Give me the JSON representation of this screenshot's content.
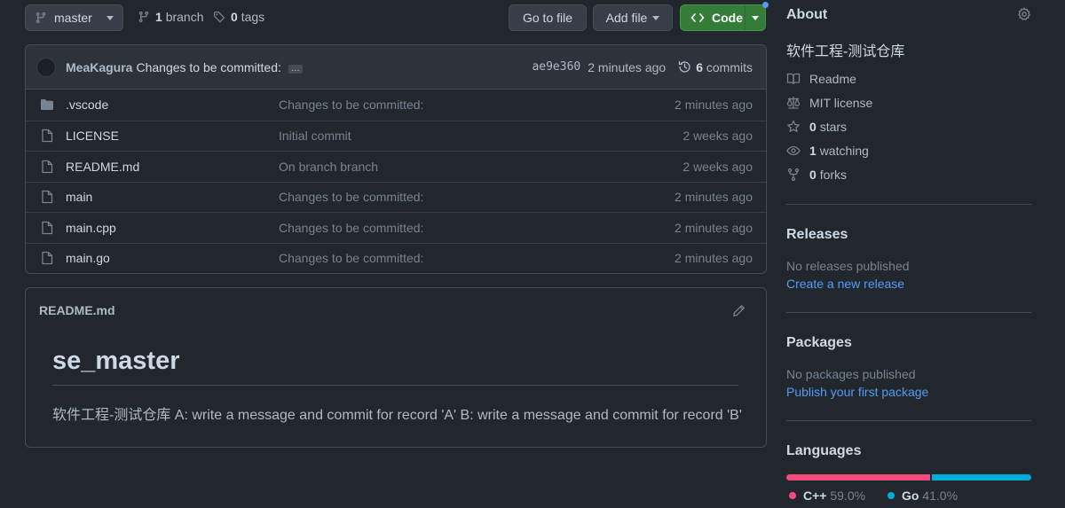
{
  "toolbar": {
    "branch_name": "master",
    "branches_count": "1",
    "branches_label": "branch",
    "tags_count": "0",
    "tags_label": "tags",
    "go_to_file": "Go to file",
    "add_file": "Add file",
    "code": "Code"
  },
  "commit": {
    "author": "MeaKagura",
    "message": "Changes to be committed:",
    "ellipsis": "…",
    "sha": "ae9e360",
    "time": "2 minutes ago",
    "commits_count": "6",
    "commits_label": "commits"
  },
  "files": [
    {
      "name": ".vscode",
      "type": "folder",
      "message": "Changes to be committed:",
      "age": "2 minutes ago"
    },
    {
      "name": "LICENSE",
      "type": "file",
      "message": "Initial commit",
      "age": "2 weeks ago"
    },
    {
      "name": "README.md",
      "type": "file",
      "message": "On branch branch",
      "age": "2 weeks ago"
    },
    {
      "name": "main",
      "type": "file",
      "message": "Changes to be committed:",
      "age": "2 minutes ago"
    },
    {
      "name": "main.cpp",
      "type": "file",
      "message": "Changes to be committed:",
      "age": "2 minutes ago"
    },
    {
      "name": "main.go",
      "type": "file",
      "message": "Changes to be committed:",
      "age": "2 minutes ago"
    }
  ],
  "readme": {
    "filename": "README.md",
    "heading": "se_master",
    "body": "软件工程-测试仓库 A: write a message and commit for record 'A' B: write a message and commit for record 'B'"
  },
  "about": {
    "title": "About",
    "description": "软件工程-测试仓库",
    "readme": "Readme",
    "license": "MIT license",
    "stars_count": "0",
    "stars_label": "stars",
    "watching_count": "1",
    "watching_label": "watching",
    "forks_count": "0",
    "forks_label": "forks"
  },
  "releases": {
    "title": "Releases",
    "empty": "No releases published",
    "create_link": "Create a new release"
  },
  "packages": {
    "title": "Packages",
    "empty": "No packages published",
    "publish_link": "Publish your first package"
  },
  "languages": {
    "title": "Languages",
    "items": [
      {
        "name": "C++",
        "percent": "59.0%",
        "value": 59.0,
        "color": "#f34b7d"
      },
      {
        "name": "Go",
        "percent": "41.0%",
        "value": 41.0,
        "color": "#00ADD8"
      }
    ]
  },
  "colors": {
    "accent": "#539bf5",
    "code_button": "#347d39",
    "background": "#22272e"
  }
}
